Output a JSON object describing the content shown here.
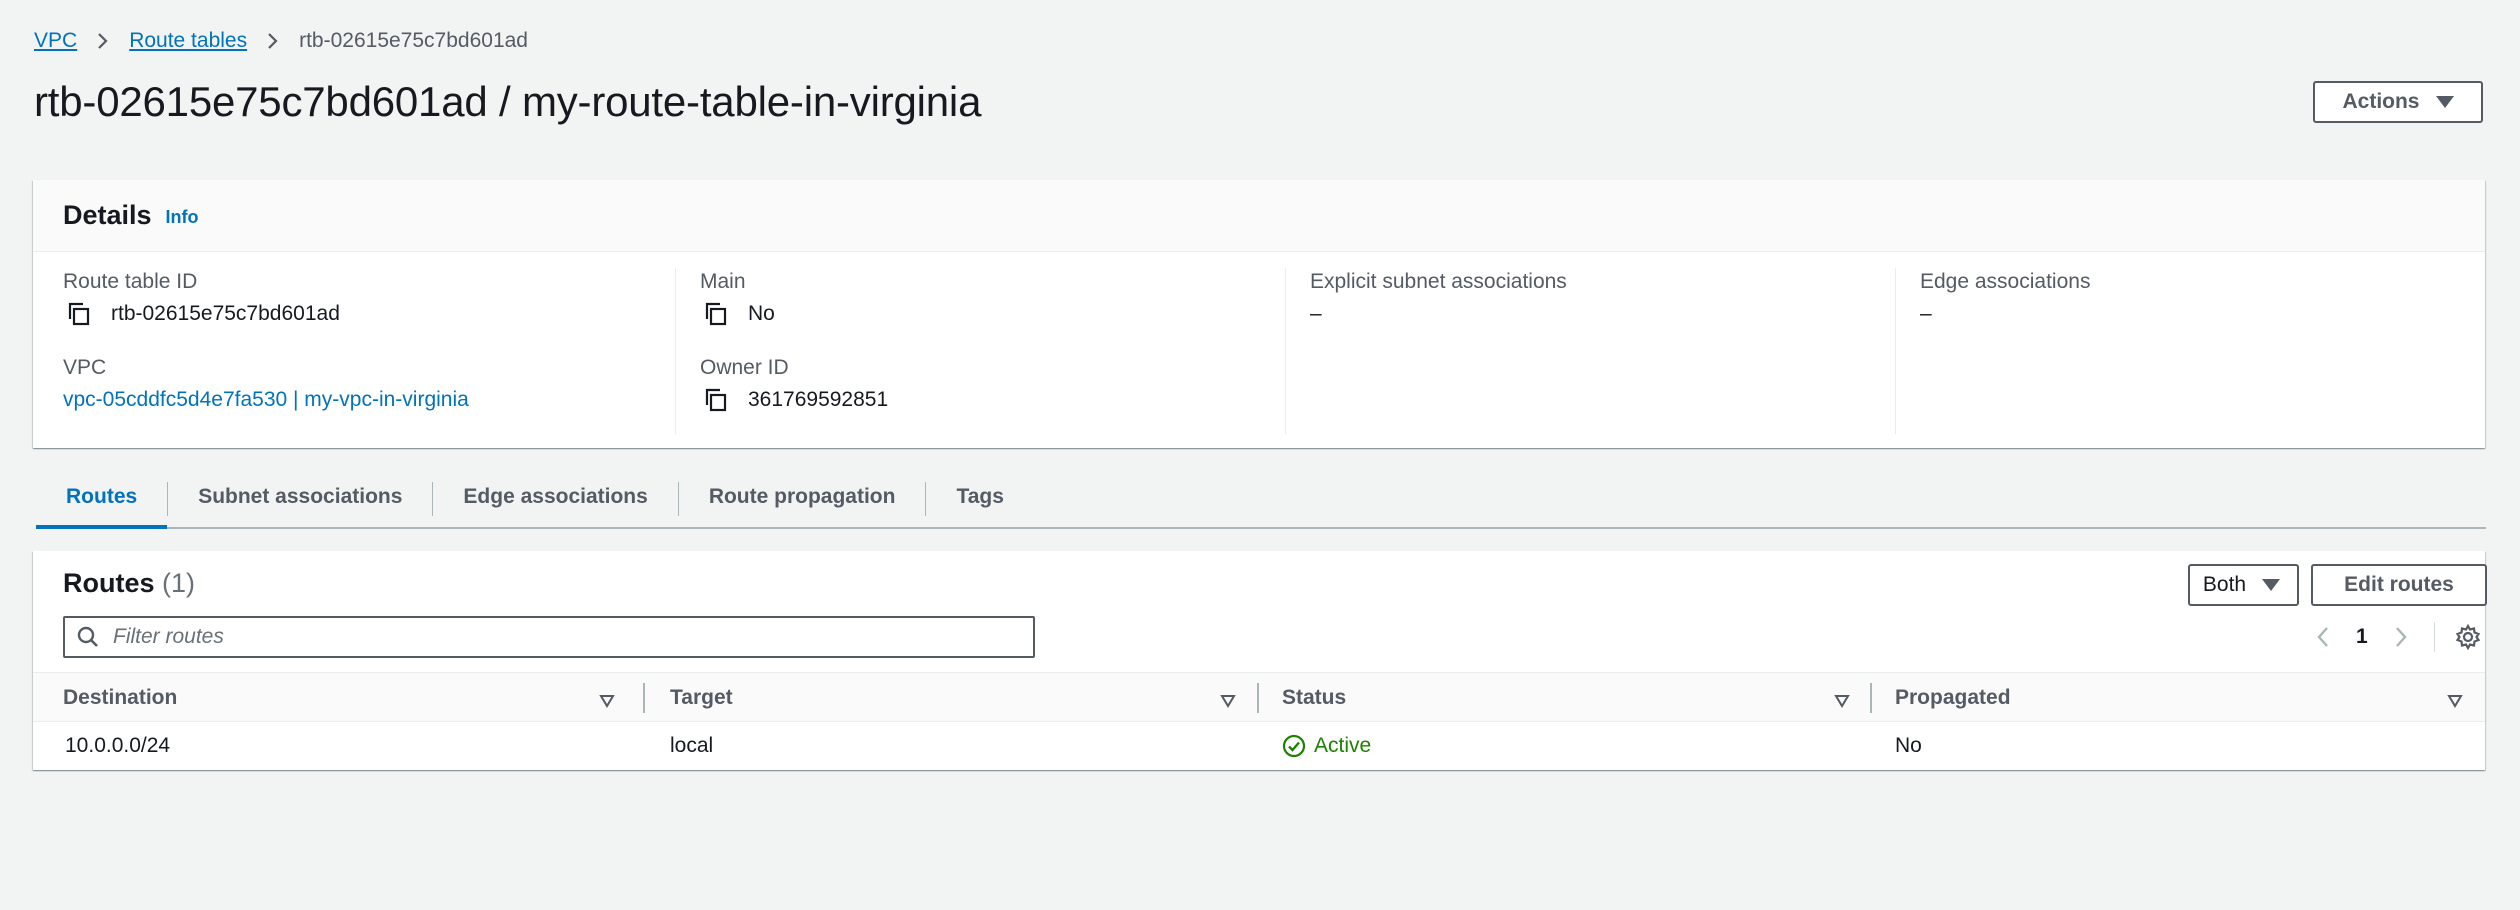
{
  "breadcrumb": {
    "items": [
      "VPC",
      "Route tables"
    ],
    "current": "rtb-02615e75c7bd601ad"
  },
  "page": {
    "title": "rtb-02615e75c7bd601ad / my-route-table-in-virginia",
    "actions_label": "Actions"
  },
  "details": {
    "heading": "Details",
    "info_label": "Info",
    "route_table_id": {
      "label": "Route table ID",
      "value": "rtb-02615e75c7bd601ad"
    },
    "vpc": {
      "label": "VPC",
      "value": "vpc-05cddfc5d4e7fa530 | my-vpc-in-virginia"
    },
    "main": {
      "label": "Main",
      "value": "No"
    },
    "owner_id": {
      "label": "Owner ID",
      "value": "361769592851"
    },
    "explicit_subnet": {
      "label": "Explicit subnet associations",
      "value": "–"
    },
    "edge_assoc": {
      "label": "Edge associations",
      "value": "–"
    }
  },
  "tabs": [
    {
      "label": "Routes",
      "active": true
    },
    {
      "label": "Subnet associations",
      "active": false
    },
    {
      "label": "Edge associations",
      "active": false
    },
    {
      "label": "Route propagation",
      "active": false
    },
    {
      "label": "Tags",
      "active": false
    }
  ],
  "routes": {
    "heading": "Routes",
    "count": "(1)",
    "filter_select": "Both",
    "edit_label": "Edit routes",
    "filter_placeholder": "Filter routes",
    "page_number": "1",
    "columns": [
      "Destination",
      "Target",
      "Status",
      "Propagated"
    ],
    "rows": [
      {
        "destination": "10.0.0.0/24",
        "target": "local",
        "status": "Active",
        "propagated": "No"
      }
    ]
  },
  "colors": {
    "link": "#0073bb",
    "status_active": "#1d8102",
    "background": "#f2f3f3"
  }
}
